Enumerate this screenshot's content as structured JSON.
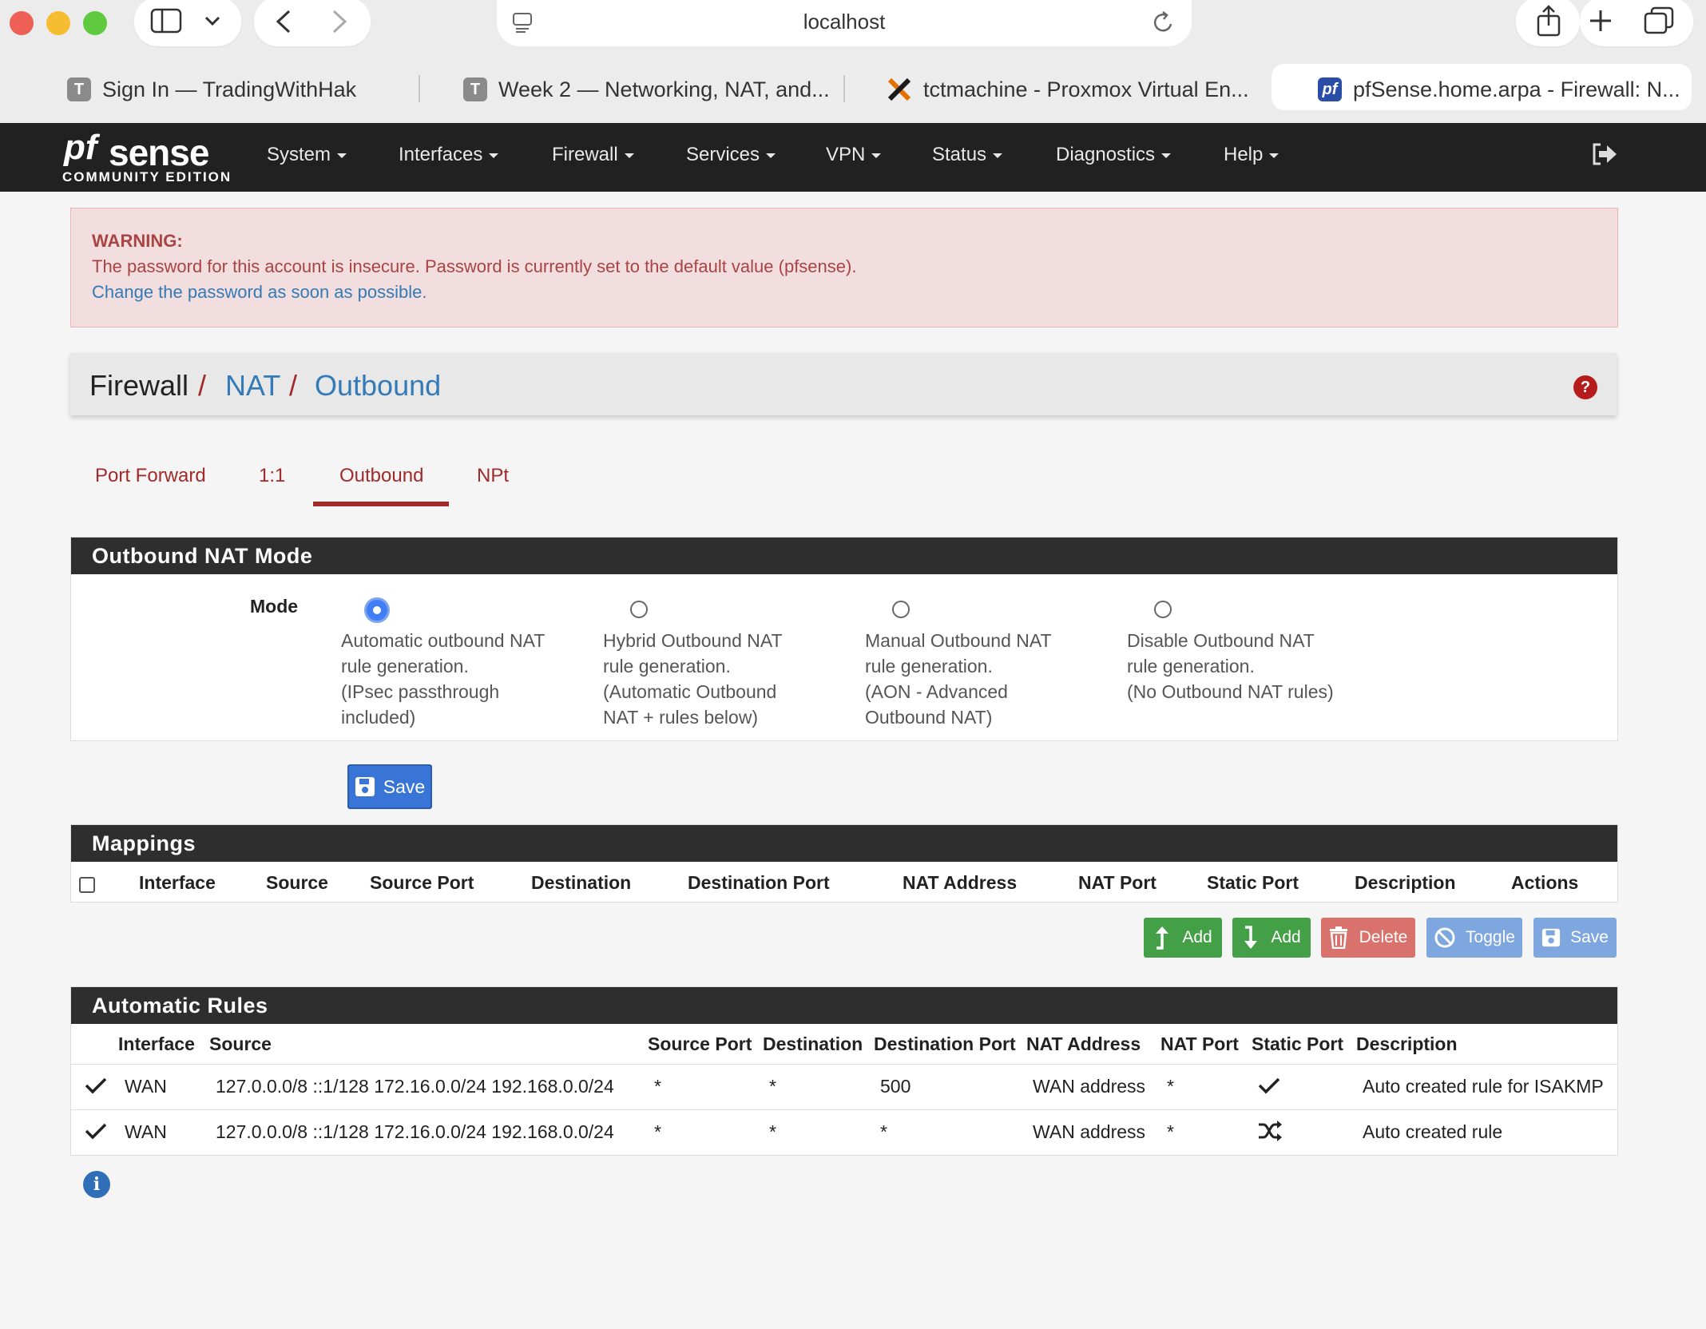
{
  "browser": {
    "url": "localhost",
    "tabs": [
      {
        "icon": "T",
        "label": "Sign In — TradingWithHak"
      },
      {
        "icon": "T",
        "label": "Week 2 — Networking, NAT, and..."
      },
      {
        "icon": "proxmox-icon",
        "label": "tctmachine - Proxmox Virtual En..."
      },
      {
        "icon": "pf",
        "label": "pfSense.home.arpa - Firewall: N..."
      }
    ]
  },
  "navbar": {
    "logo_pf": "pf",
    "logo_sense": "sense",
    "logo_edition": "COMMUNITY EDITION",
    "items": [
      "System",
      "Interfaces",
      "Firewall",
      "Services",
      "VPN",
      "Status",
      "Diagnostics",
      "Help"
    ]
  },
  "warning": {
    "title": "WARNING:",
    "message": "The password for this account is insecure. Password is currently set to the default value (pfsense).",
    "link": "Change the password as soon as possible."
  },
  "breadcrumb": {
    "root": "Firewall",
    "sep": "/",
    "level1": "NAT",
    "level2": "Outbound",
    "help": "?"
  },
  "subtabs": [
    "Port Forward",
    "1:1",
    "Outbound",
    "NPt"
  ],
  "mode_panel": {
    "title": "Outbound NAT Mode",
    "label": "Mode",
    "options": [
      {
        "lines": [
          "Automatic outbound NAT",
          "rule generation.",
          "(IPsec passthrough",
          "included)"
        ],
        "selected": true
      },
      {
        "lines": [
          "Hybrid Outbound NAT",
          "rule generation.",
          "(Automatic Outbound",
          "NAT + rules below)"
        ],
        "selected": false
      },
      {
        "lines": [
          "Manual Outbound NAT",
          "rule generation.",
          "(AON - Advanced",
          "Outbound NAT)"
        ],
        "selected": false
      },
      {
        "lines": [
          "Disable Outbound NAT",
          "rule generation.",
          "(No Outbound NAT rules)"
        ],
        "selected": false
      }
    ],
    "save_label": "Save"
  },
  "mappings": {
    "title": "Mappings",
    "columns": [
      "Interface",
      "Source",
      "Source Port",
      "Destination",
      "Destination Port",
      "NAT Address",
      "NAT Port",
      "Static Port",
      "Description",
      "Actions"
    ],
    "buttons": {
      "add_top": "Add",
      "add_bottom": "Add",
      "delete": "Delete",
      "toggle": "Toggle",
      "save": "Save"
    }
  },
  "automatic_rules": {
    "title": "Automatic Rules",
    "columns": [
      "Interface",
      "Source",
      "Source Port",
      "Destination",
      "Destination Port",
      "NAT Address",
      "NAT Port",
      "Static Port",
      "Description"
    ],
    "rows": [
      {
        "interface": "WAN",
        "source": "127.0.0.0/8 ::1/128 172.16.0.0/24 192.168.0.0/24",
        "source_port": "*",
        "destination": "*",
        "destination_port": "500",
        "nat_address": "WAN address",
        "nat_port": "*",
        "static_port": "check-icon",
        "description": "Auto created rule for ISAKMP"
      },
      {
        "interface": "WAN",
        "source": "127.0.0.0/8 ::1/128 172.16.0.0/24 192.168.0.0/24",
        "source_port": "*",
        "destination": "*",
        "destination_port": "*",
        "nat_address": "WAN address",
        "nat_port": "*",
        "static_port": "random-icon",
        "description": "Auto created rule"
      }
    ]
  },
  "info_icon": "i"
}
